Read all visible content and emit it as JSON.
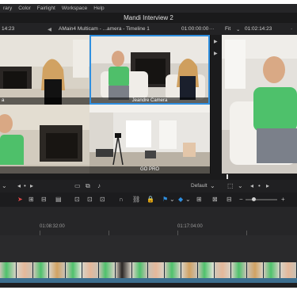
{
  "menu": [
    "rary",
    "Color",
    "Fairlight",
    "Workspace",
    "Help"
  ],
  "project_title": "Mandi Interview 2",
  "viewer": {
    "left_timecode": "14:23",
    "clip_title": "AMain4 Multicam - ...amera - Timeline 1",
    "source_timecode": "01:00:00:00",
    "fit_label": "Fit",
    "program_timecode": "01:02:14:23"
  },
  "cameras": [
    {
      "label": "a"
    },
    {
      "label": "Jeandre Camera"
    },
    {
      "label": ""
    },
    {
      "label": "GO PRO"
    }
  ],
  "controls": {
    "layout_label": "Default"
  },
  "timeline": {
    "tc_1": "01:08:32:00",
    "tc_2": "01:17:04:00"
  }
}
